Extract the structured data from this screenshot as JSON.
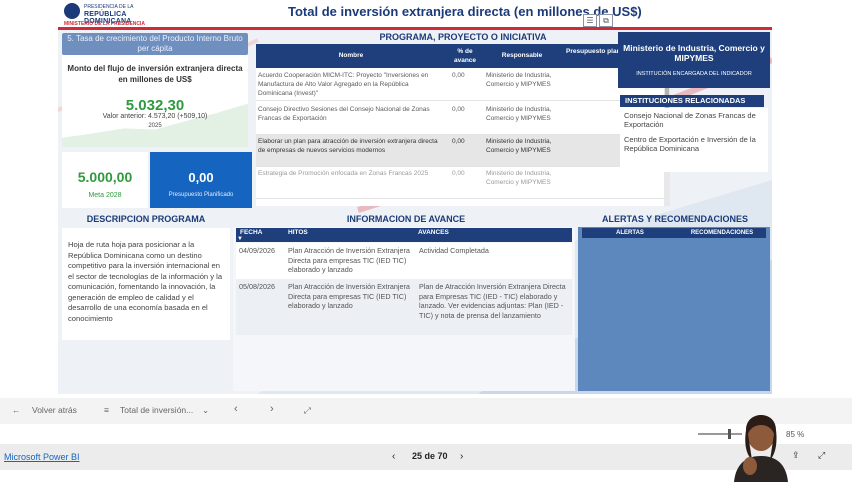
{
  "report": {
    "logo": {
      "line1": "PRESIDENCIA DE LA",
      "line2": "REPÚBLICA DOMINICANA",
      "line3": "MINISTERIO DE LA PRESIDENCIA"
    },
    "title": "Total de inversión extranjera directa (en millones de US$)",
    "icons": {
      "filter": "filter-icon",
      "focus": "focus-mode-icon"
    }
  },
  "kpi": {
    "header": "5. Tasa de crecimiento del Producto Interno Bruto per cápita",
    "label": "Monto del flujo de inversión extranjera directa en millones de US$",
    "value": "5.032,30",
    "previous": "Valor anterior: 4.573,20 (+509,10)",
    "year": "2025",
    "trend": [
      0.15,
      0.22,
      0.3,
      0.28,
      0.42,
      0.55,
      0.7
    ],
    "meta_value": "5.000,00",
    "meta_label": "Meta 2028",
    "budget_value": "0,00",
    "budget_label": "Presupuesto Planificado"
  },
  "program": {
    "title": "PROGRAMA, PROYECTO O INICIATIVA",
    "columns": [
      "Nombre",
      "% de avance",
      "Responsable",
      "Presupuesto planificado"
    ],
    "rows": [
      {
        "name": "Acuerdo Cooperación MICM-ITC: Proyecto \"Inversiones en Manufactura de Alto Valor Agregado en la República Dominicana (Invest)\"",
        "pct": "0,00",
        "resp": "Ministerio de Industria, Comercio y MIPYMES"
      },
      {
        "name": "Consejo Directivo Sesiones del Consejo Nacional de Zonas Francas de Exportación",
        "pct": "0,00",
        "resp": "Ministerio de Industria, Comercio y MIPYMES"
      },
      {
        "name": "Elaborar un plan para atracción de inversión extranjera directa de empresas de nuevos servicios modernos",
        "pct": "0,00",
        "resp": "Ministerio de Industria, Comercio y MIPYMES"
      },
      {
        "name": "Estrategia de Promoción enfocada en Zonas Francas 2025",
        "pct": "0,00",
        "resp": "Ministerio de Industria, Comercio y MIPYMES"
      }
    ]
  },
  "responsible": {
    "name": "Ministerio de Industria, Comercio y MIPYMES",
    "role": "INSTITUCIÓN ENCARGADA DEL INDICADOR"
  },
  "institutions": {
    "title": "INSTITUCIONES RELACIONADAS",
    "items": [
      "Consejo Nacional de Zonas Francas de Exportación",
      "Centro de Exportación e Inversión de la República Dominicana"
    ]
  },
  "description": {
    "title": "DESCRIPCION PROGRAMA",
    "text": "Hoja de ruta hoja para posicionar a la República Dominicana como un destino competitivo para la inversión internacional en el sector de tecnologías de la información y la comunicación, fomentando la innovación, la generación de empleo de calidad y el desarrollo de una economía basada en el conocimiento"
  },
  "progress": {
    "title": "INFORMACION DE AVANCE",
    "columns": [
      "FECHA",
      "HITOS",
      "AVANCES"
    ],
    "rows": [
      {
        "date": "04/09/2026",
        "milestone": "Plan Atracción de Inversión Extranjera Directa para empresas TIC (IED TIC) elaborado y lanzado",
        "advance": "Actividad Completada"
      },
      {
        "date": "05/08/2026",
        "milestone": "Plan Atracción de Inversión Extranjera Directa para empresas TIC (IED TIC) elaborado y lanzado",
        "advance": "Plan de Atracción Inversión Extranjera Directa para Empresas TIC (IED - TIC) elaborado y lanzado. Ver evidencias adjuntas: Plan (IED - TIC) y nota de prensa del lanzamiento"
      }
    ]
  },
  "alerts": {
    "title": "ALERTAS Y RECOMENDACIONES",
    "columns": [
      "ALERTAS",
      "RECOMENDACIONES"
    ]
  },
  "viewer": {
    "back": "Volver atrás",
    "page_menu": "Total de inversión...",
    "brand": "Microsoft Power BI",
    "page_counter": "25 de 70",
    "zoom": "85 %"
  }
}
